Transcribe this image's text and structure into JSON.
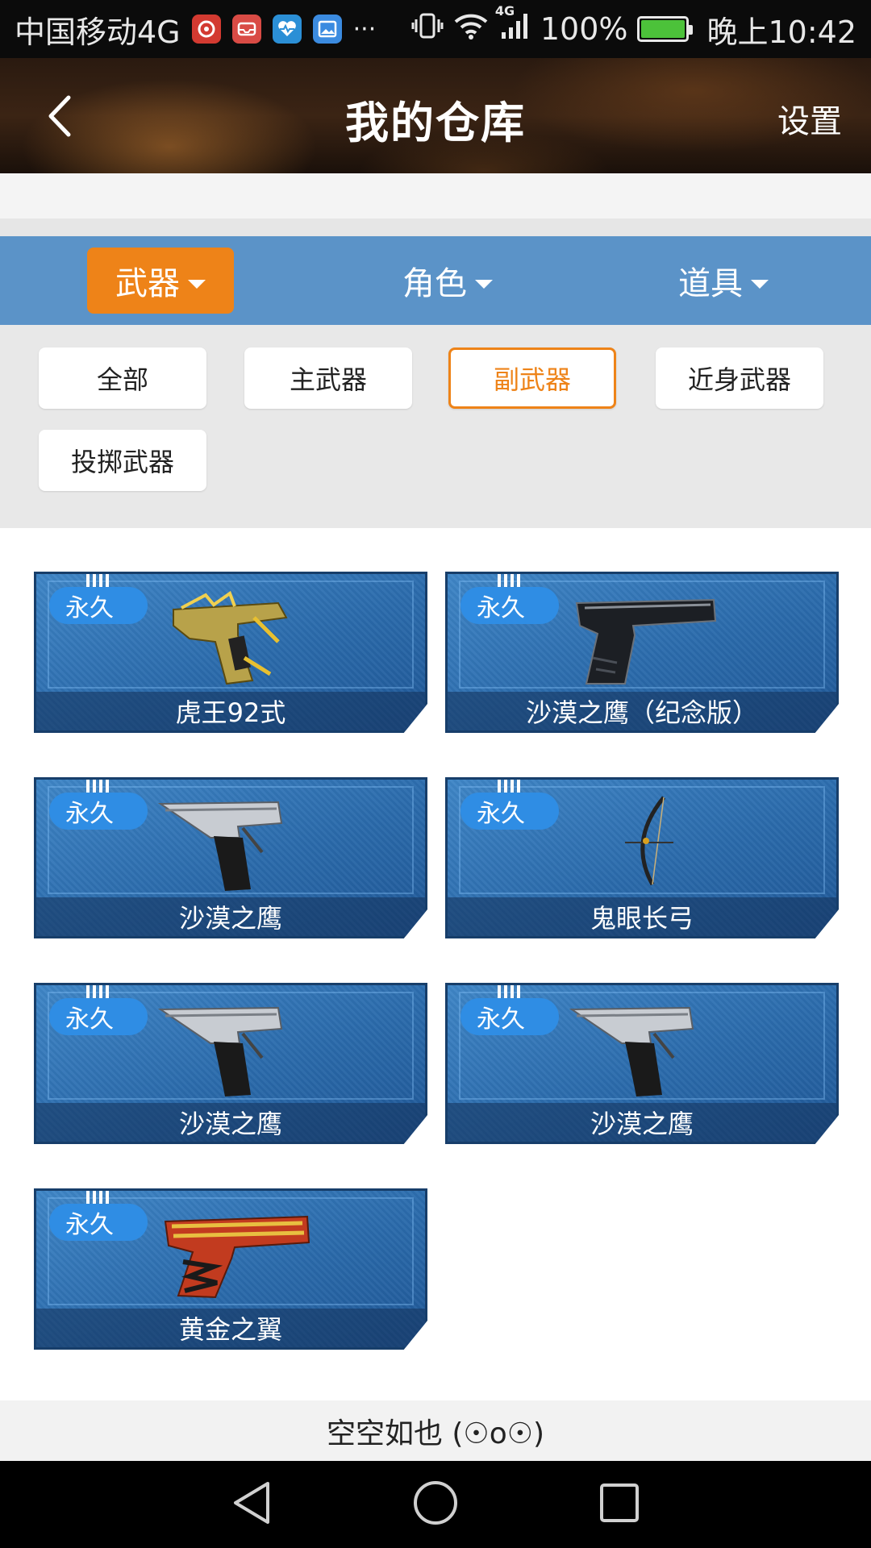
{
  "status_bar": {
    "carrier": "中国移动4G",
    "network": "4G",
    "battery": "100%",
    "time": "晚上10:42",
    "more": "···"
  },
  "header": {
    "title": "我的仓库",
    "settings_label": "设置"
  },
  "categories": [
    {
      "label": "武器",
      "active": true
    },
    {
      "label": "角色",
      "active": false
    },
    {
      "label": "道具",
      "active": false
    }
  ],
  "sub_filters": [
    {
      "label": "全部",
      "active": false
    },
    {
      "label": "主武器",
      "active": false
    },
    {
      "label": "副武器",
      "active": true
    },
    {
      "label": "近身武器",
      "active": false
    },
    {
      "label": "投掷武器",
      "active": false
    }
  ],
  "weapons": [
    {
      "badge": "永久",
      "name": "虎王92式",
      "icon": "gold-tiger-pistol-icon"
    },
    {
      "badge": "永久",
      "name": "沙漠之鹰（纪念版）",
      "icon": "black-desert-eagle-icon"
    },
    {
      "badge": "永久",
      "name": "沙漠之鹰",
      "icon": "desert-eagle-icon"
    },
    {
      "badge": "永久",
      "name": "鬼眼长弓",
      "icon": "longbow-icon"
    },
    {
      "badge": "永久",
      "name": "沙漠之鹰",
      "icon": "desert-eagle-icon"
    },
    {
      "badge": "永久",
      "name": "沙漠之鹰",
      "icon": "desert-eagle-icon"
    },
    {
      "badge": "永久",
      "name": "黄金之翼",
      "icon": "red-gold-pistol-icon"
    }
  ],
  "footer": {
    "empty_text": "空空如也 (☉o☉)"
  },
  "colors": {
    "accent": "#ee8318",
    "category_bar": "#5b93c8",
    "badge": "#2f8de4"
  }
}
